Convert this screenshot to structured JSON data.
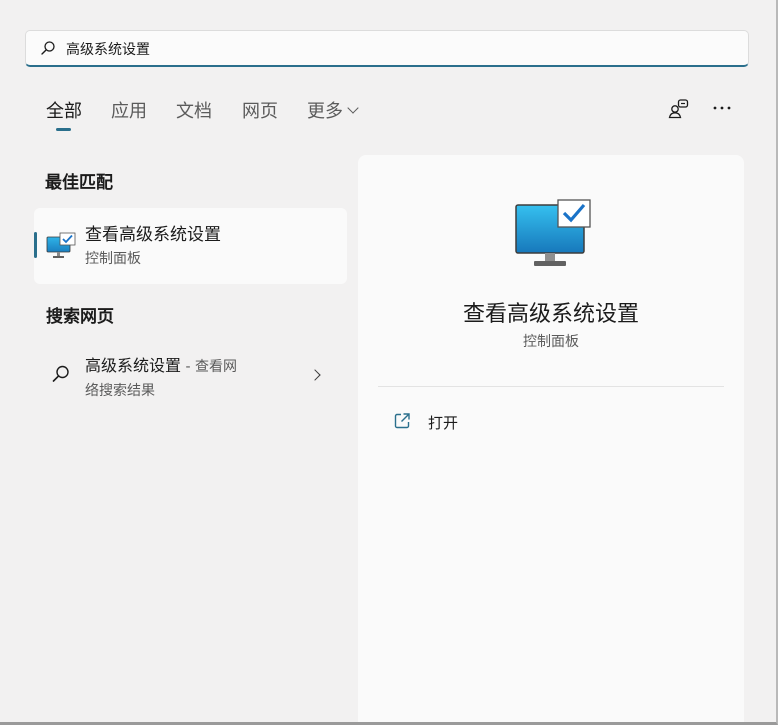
{
  "search": {
    "query": "高级系统设置",
    "icon": "search-icon"
  },
  "tabs": [
    {
      "label": "全部",
      "active": true
    },
    {
      "label": "应用"
    },
    {
      "label": "文档"
    },
    {
      "label": "网页"
    },
    {
      "label": "更多"
    }
  ],
  "top_icons": [
    "people-icon",
    "more-icon"
  ],
  "best_match": {
    "heading": "最佳匹配",
    "title": "查看高级系统设置",
    "subtitle": "控制面板",
    "icon": "monitor-check-icon"
  },
  "web_search": {
    "heading": "搜索网页",
    "title": "高级系统设置",
    "suffix": " - 查看网",
    "line2": "络搜索结果",
    "icon": "search-icon"
  },
  "detail": {
    "title": "查看高级系统设置",
    "subtitle": "控制面板",
    "icon": "monitor-check-icon",
    "actions": [
      {
        "label": "打开",
        "icon": "open-external-icon"
      }
    ]
  },
  "colors": {
    "accent": "#2a6f8c",
    "window_bg": "#f2f1f1",
    "panel_bg": "#fafafa"
  }
}
